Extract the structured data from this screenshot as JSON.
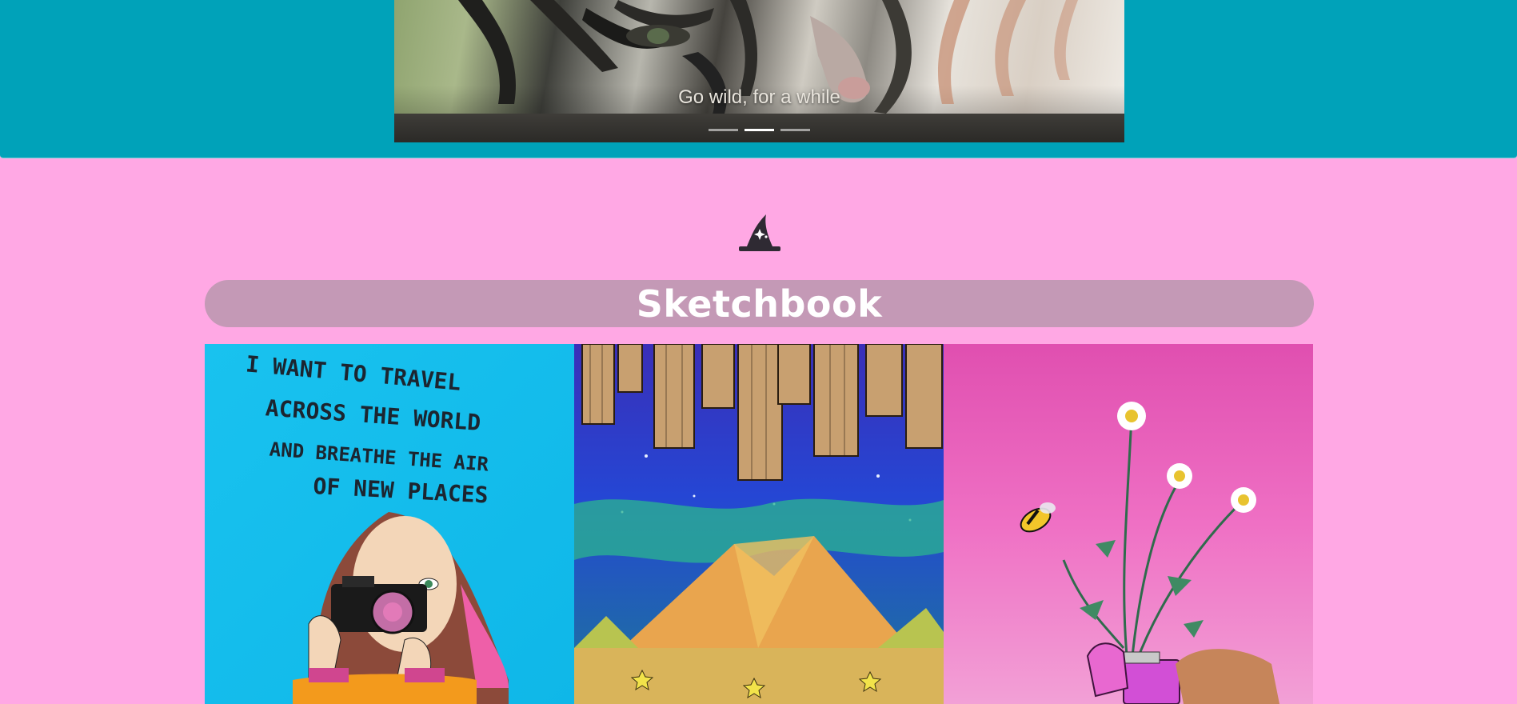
{
  "carousel": {
    "caption": "Go wild, for a while",
    "indicators": [
      {
        "label": "slide-1",
        "active": false
      },
      {
        "label": "slide-2",
        "active": true
      },
      {
        "label": "slide-3",
        "active": false
      }
    ]
  },
  "sketchbook": {
    "icon": "wizard-hat-icon",
    "title": "Sketchbook",
    "tiles": [
      {
        "subject": "travel-girl-camera",
        "text_lines": [
          "I WANT TO TRAVEL",
          "ACROSS THE WORLD",
          "AND BREATHE THE AIR",
          "OF NEW PLACES"
        ]
      },
      {
        "subject": "city-mountains-night"
      },
      {
        "subject": "daisies-lighter-bee"
      }
    ]
  },
  "colors": {
    "hero_background": "#00a2b9",
    "page_background": "#ffa8e4",
    "title_bar": "#c499b6"
  }
}
